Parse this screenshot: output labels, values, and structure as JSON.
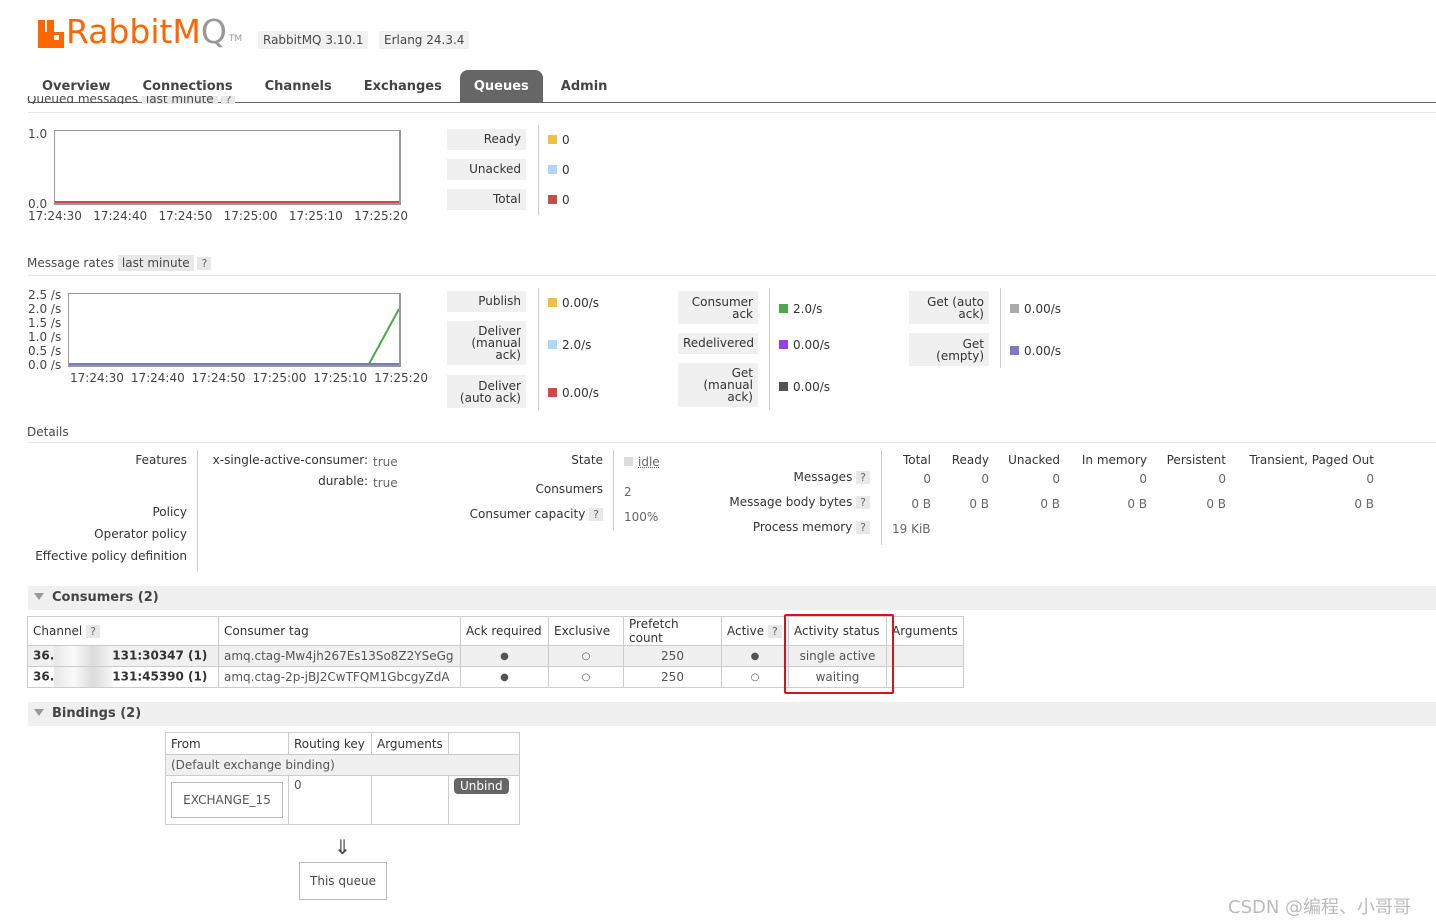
{
  "header": {
    "logo_text_a": "RabbitM",
    "logo_text_b": "Q",
    "tm": "TM",
    "version": "RabbitMQ 3.10.1",
    "erlang": "Erlang 24.3.4"
  },
  "tabs": [
    "Overview",
    "Connections",
    "Channels",
    "Exchanges",
    "Queues",
    "Admin"
  ],
  "queued_messages": {
    "title_a": "Queued messages",
    "title_b": "last minute",
    "help": "?",
    "y_ticks": [
      "1.0",
      "0.0"
    ],
    "x_ticks": [
      "17:24:30",
      "17:24:40",
      "17:24:50",
      "17:25:00",
      "17:25:10",
      "17:25:20"
    ],
    "legend": [
      {
        "label": "Ready",
        "value": "0",
        "color": "#edc240"
      },
      {
        "label": "Unacked",
        "value": "0",
        "color": "#afd8f8"
      },
      {
        "label": "Total",
        "value": "0",
        "color": "#cb4b4b"
      }
    ]
  },
  "message_rates": {
    "title": "Message rates",
    "range": "last minute",
    "help": "?",
    "y_ticks": [
      "2.5 /s",
      "2.0 /s",
      "1.5 /s",
      "1.0 /s",
      "0.5 /s",
      "0.0 /s"
    ],
    "x_ticks": [
      "17:24:30",
      "17:24:40",
      "17:24:50",
      "17:25:00",
      "17:25:10",
      "17:25:20"
    ],
    "col1": [
      {
        "label": "Publish",
        "value": "0.00/s",
        "color": "#edc240"
      },
      {
        "label": "Deliver (manual ack)",
        "value": "2.0/s",
        "color": "#afd8f8"
      },
      {
        "label": "Deliver (auto ack)",
        "value": "0.00/s",
        "color": "#cb4b4b"
      }
    ],
    "col2": [
      {
        "label": "Consumer ack",
        "value": "2.0/s",
        "color": "#4da74d"
      },
      {
        "label": "Redelivered",
        "value": "0.00/s",
        "color": "#9440ed"
      },
      {
        "label": "Get (manual ack)",
        "value": "0.00/s",
        "color": "#545454"
      }
    ],
    "col3": [
      {
        "label": "Get (auto ack)",
        "value": "0.00/s",
        "color": "#aaaaaa"
      },
      {
        "label": "Get (empty)",
        "value": "0.00/s",
        "color": "#7c79c3"
      }
    ]
  },
  "details": {
    "title": "Details",
    "features_label": "Features",
    "feature1_key": "x-single-active-consumer:",
    "feature1_val": "true",
    "feature2_key": "durable:",
    "feature2_val": "true",
    "policy_label": "Policy",
    "operator_policy_label": "Operator policy",
    "effective_policy_label": "Effective policy definition",
    "state_label": "State",
    "state_value": "idle",
    "consumers_label": "Consumers",
    "consumers_value": "2",
    "capacity_label": "Consumer capacity",
    "capacity_value": "100%",
    "help": "?",
    "stats_headers": [
      "Total",
      "Ready",
      "Unacked",
      "In memory",
      "Persistent",
      "Transient, Paged Out"
    ],
    "messages_label": "Messages",
    "messages_values": [
      "0",
      "0",
      "0",
      "0",
      "0",
      "0"
    ],
    "bytes_label": "Message body bytes",
    "bytes_values": [
      "0 B",
      "0 B",
      "0 B",
      "0 B",
      "0 B",
      "0 B"
    ],
    "process_memory_label": "Process memory",
    "process_memory_value": "19 KiB"
  },
  "consumers": {
    "title": "Consumers (2)",
    "headers": [
      "Channel",
      "Consumer tag",
      "Ack required",
      "Exclusive",
      "Prefetch count",
      "Active",
      "Activity status",
      "Arguments"
    ],
    "help": "?",
    "rows": [
      {
        "channel_a": "36.",
        "channel_b": "131:30347 (1)",
        "tag": "amq.ctag-Mw4jh267Es13So8Z2YSeGg",
        "ack": "●",
        "exclusive": "○",
        "prefetch": "250",
        "active": "●",
        "status": "single active",
        "args": ""
      },
      {
        "channel_a": "36.",
        "channel_b": "131:45390 (1)",
        "tag": "amq.ctag-2p-jBJ2CwTFQM1GbcgyZdA",
        "ack": "●",
        "exclusive": "○",
        "prefetch": "250",
        "active": "○",
        "status": "waiting",
        "args": ""
      }
    ]
  },
  "bindings": {
    "title": "Bindings (2)",
    "headers": [
      "From",
      "Routing key",
      "Arguments"
    ],
    "default_row": "(Default exchange binding)",
    "exchange": "EXCHANGE_15",
    "routing_key": "0",
    "unbind": "Unbind",
    "arrow": "⇓",
    "this_queue": "This queue"
  },
  "watermark": "CSDN @编程、小哥哥"
}
